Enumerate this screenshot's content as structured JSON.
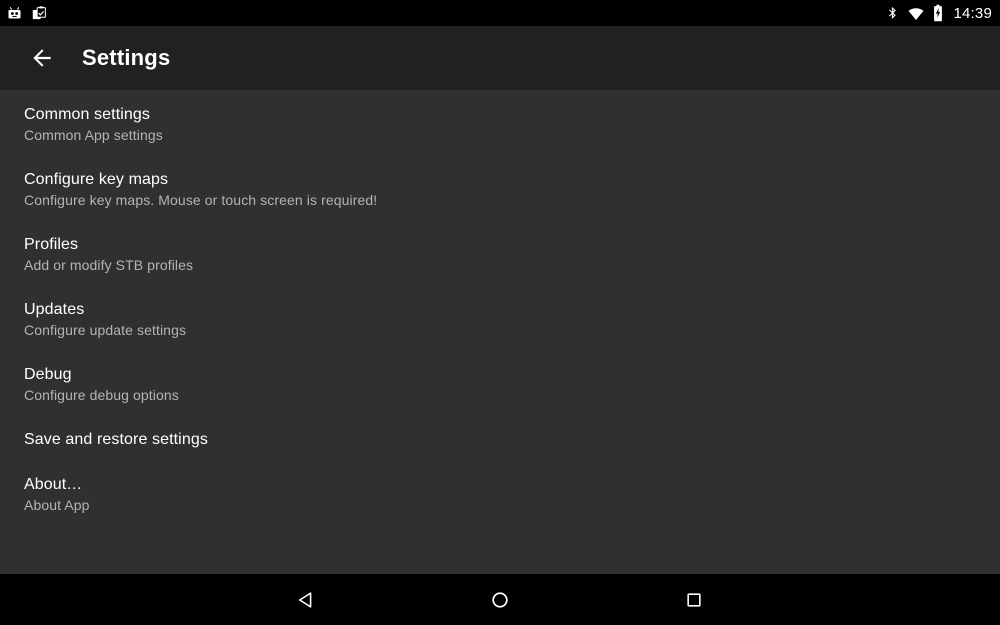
{
  "status_bar": {
    "left_icons": [
      {
        "name": "robot-face-icon",
        "label": "robot-face"
      },
      {
        "name": "clipboard-check-icon",
        "label": "clipboard-check"
      }
    ],
    "right_icons": [
      {
        "name": "bluetooth-icon",
        "label": "bluetooth"
      },
      {
        "name": "wifi-icon",
        "label": "wifi-full-signal"
      },
      {
        "name": "battery-charging-icon",
        "label": "battery-charging"
      }
    ],
    "time": "14:39"
  },
  "toolbar": {
    "back_label": "back-arrow",
    "title": "Settings"
  },
  "settings_list": [
    {
      "title": "Common settings",
      "summary": "Common App settings"
    },
    {
      "title": "Configure key maps",
      "summary": "Configure key maps. Mouse or touch screen is required!"
    },
    {
      "title": "Profiles",
      "summary": "Add or modify STB profiles"
    },
    {
      "title": "Updates",
      "summary": "Configure update settings"
    },
    {
      "title": "Debug",
      "summary": "Configure debug options"
    },
    {
      "title": "Save and restore settings",
      "summary": ""
    },
    {
      "title": "About…",
      "summary": "About App"
    }
  ],
  "nav_bar": {
    "back": "back-triangle",
    "home": "home-circle",
    "recents": "recents-square"
  },
  "colors": {
    "status_bar_bg": "#000000",
    "toolbar_bg": "#212121",
    "content_bg": "#303030",
    "nav_bar_bg": "#000000",
    "primary_text": "#ffffff",
    "secondary_text": "#b4b4b4"
  }
}
